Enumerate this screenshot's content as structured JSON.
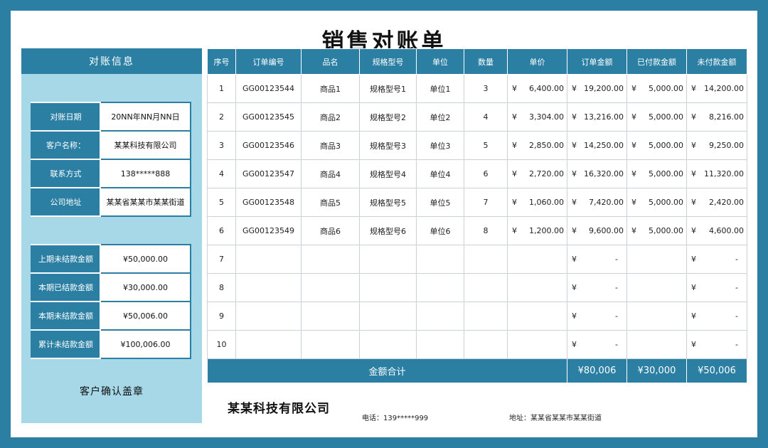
{
  "title": "销售对账单",
  "left": {
    "header": "对账信息",
    "info": [
      {
        "key": "对账日期",
        "value": "20NN年NN月NN日"
      },
      {
        "key": "客户名称：",
        "value": "某某科技有限公司"
      },
      {
        "key": "联系方式",
        "value": "138*****888"
      },
      {
        "key": "公司地址",
        "value": "某某省某某市某某街道"
      }
    ],
    "amounts": [
      {
        "key": "上期未结款金额",
        "value": "¥50,000.00"
      },
      {
        "key": "本期已结款金额",
        "value": "¥30,000.00"
      },
      {
        "key": "本期未结款金额",
        "value": "¥50,006.00"
      },
      {
        "key": "累计未结款金额",
        "value": "¥100,006.00"
      }
    ],
    "confirm": "客户确认盖章"
  },
  "table": {
    "headers": [
      "序号",
      "订单编号",
      "品名",
      "规格型号",
      "单位",
      "数量",
      "单价",
      "订单金额",
      "已付款金额",
      "未付款金额"
    ],
    "currency": "¥",
    "rows": [
      {
        "no": "1",
        "order": "GG00123544",
        "name": "商品1",
        "spec": "规格型号1",
        "unit": "单位1",
        "qty": "3",
        "price": "6,400.00",
        "amount": "19,200.00",
        "paid": "5,000.00",
        "unpaid": "14,200.00"
      },
      {
        "no": "2",
        "order": "GG00123545",
        "name": "商品2",
        "spec": "规格型号2",
        "unit": "单位2",
        "qty": "4",
        "price": "3,304.00",
        "amount": "13,216.00",
        "paid": "5,000.00",
        "unpaid": "8,216.00"
      },
      {
        "no": "3",
        "order": "GG00123546",
        "name": "商品3",
        "spec": "规格型号3",
        "unit": "单位3",
        "qty": "5",
        "price": "2,850.00",
        "amount": "14,250.00",
        "paid": "5,000.00",
        "unpaid": "9,250.00"
      },
      {
        "no": "4",
        "order": "GG00123547",
        "name": "商品4",
        "spec": "规格型号4",
        "unit": "单位4",
        "qty": "6",
        "price": "2,720.00",
        "amount": "16,320.00",
        "paid": "5,000.00",
        "unpaid": "11,320.00"
      },
      {
        "no": "5",
        "order": "GG00123548",
        "name": "商品5",
        "spec": "规格型号5",
        "unit": "单位5",
        "qty": "7",
        "price": "1,060.00",
        "amount": "7,420.00",
        "paid": "5,000.00",
        "unpaid": "2,420.00"
      },
      {
        "no": "6",
        "order": "GG00123549",
        "name": "商品6",
        "spec": "规格型号6",
        "unit": "单位6",
        "qty": "8",
        "price": "1,200.00",
        "amount": "9,600.00",
        "paid": "5,000.00",
        "unpaid": "4,600.00"
      },
      {
        "no": "7",
        "amount": "-",
        "unpaid": "-"
      },
      {
        "no": "8",
        "amount": "-",
        "unpaid": "-"
      },
      {
        "no": "9",
        "amount": "-",
        "unpaid": "-"
      },
      {
        "no": "10",
        "amount": "-",
        "unpaid": "-"
      }
    ],
    "total_label": "金额合计",
    "total_amount": "¥80,006",
    "total_paid": "¥30,000",
    "total_unpaid": "¥50,006"
  },
  "footer": {
    "company": "某某科技有限公司",
    "phone": "电话：139*****999",
    "address": "地址：某某省某某市某某街道"
  }
}
